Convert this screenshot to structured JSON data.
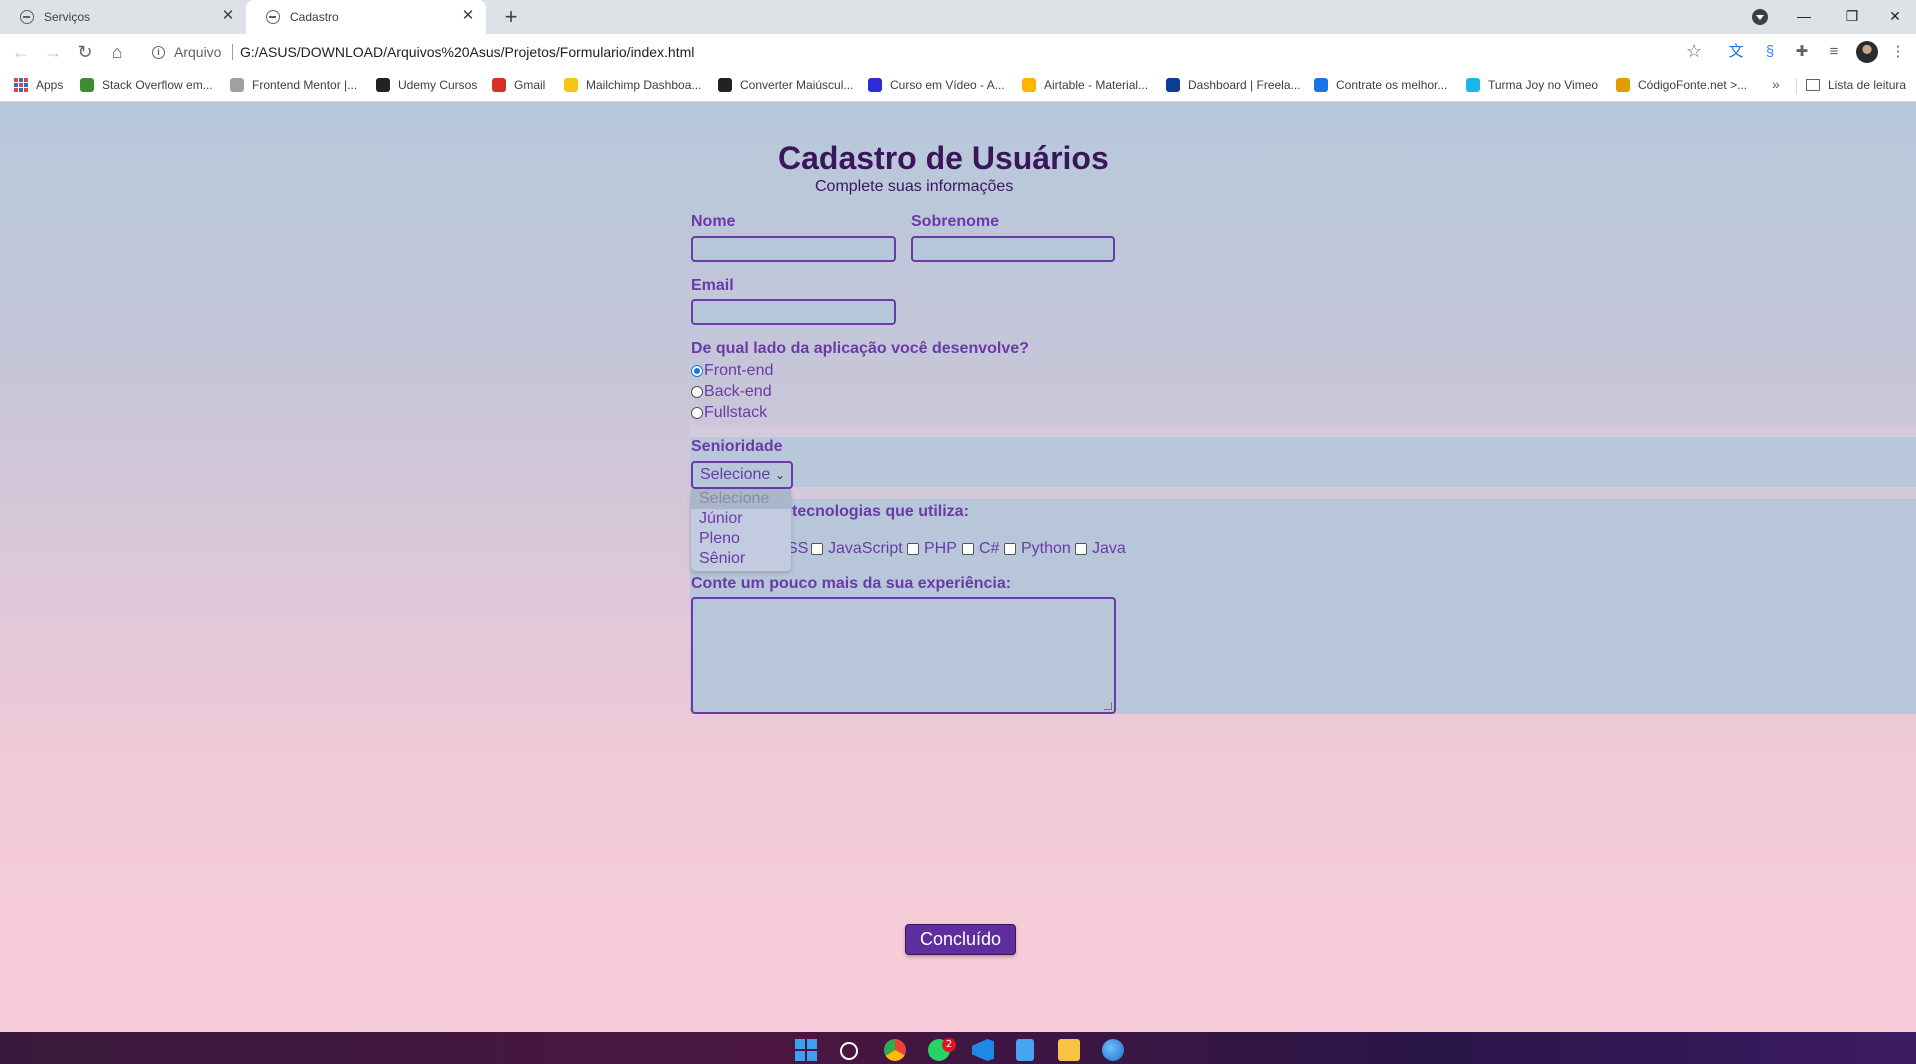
{
  "browser": {
    "tabs": [
      {
        "title": "Serviços",
        "close": "✕"
      },
      {
        "title": "Cadastro",
        "close": "✕"
      }
    ],
    "new_tab": "+",
    "window_controls": {
      "minimize": "—",
      "restore": "❐",
      "close": "✕"
    },
    "nav": {
      "back": "←",
      "forward": "→",
      "reload": "↻",
      "home": "⌂"
    },
    "omnibox": {
      "info": "i",
      "scheme_label": "Arquivo",
      "url": "G:/ASUS/DOWNLOAD/Arquivos%20Asus/Projetos/Formulario/index.html",
      "star": "☆"
    },
    "extension_icons": [
      "translate-icon",
      "extension-s-icon",
      "puzzle-icon",
      "media-icon"
    ],
    "bookmarks": [
      {
        "label": "Apps",
        "color": "#1a73e8"
      },
      {
        "label": "Stack Overflow em...",
        "color": "#3c8d2f"
      },
      {
        "label": "Frontend Mentor |...",
        "color": "#a0a0a0"
      },
      {
        "label": "Udemy Cursos",
        "color": "#222222"
      },
      {
        "label": "Gmail",
        "color": "#d93025"
      },
      {
        "label": "Mailchimp Dashboa...",
        "color": "#f2c811"
      },
      {
        "label": "Converter Maiúscul...",
        "color": "#222222"
      },
      {
        "label": "Curso em Vídeo - A...",
        "color": "#2b2bd8"
      },
      {
        "label": "Airtable - Material...",
        "color": "#fcb400"
      },
      {
        "label": "Dashboard | Freela...",
        "color": "#0b3d91"
      },
      {
        "label": "Contrate os melhor...",
        "color": "#1a73e8"
      },
      {
        "label": "Turma Joy no Vimeo",
        "color": "#1ab7ea"
      },
      {
        "label": "CódigoFonte.net >...",
        "color": "#e09b00"
      }
    ],
    "bookmarks_more": "»",
    "reading_list": "Lista de leitura"
  },
  "form": {
    "title": "Cadastro de Usuários",
    "subtitle": "Complete suas informações",
    "nome_label": "Nome",
    "sobrenome_label": "Sobrenome",
    "email_label": "Email",
    "side_question": "De qual lado da aplicação você desenvolve?",
    "side_options": [
      {
        "label": "Front-end",
        "checked": true
      },
      {
        "label": "Back-end",
        "checked": false
      },
      {
        "label": "Fullstack",
        "checked": false
      }
    ],
    "seniority_label": "Senioridade",
    "seniority_selected": "Selecione",
    "seniority_chevron": "⌄",
    "seniority_options": [
      "Selecione",
      "Júnior",
      "Pleno",
      "Sênior"
    ],
    "tech_label_visible": "tecnologias que utiliza:",
    "tech_options_visible": [
      "SS",
      "JavaScript",
      "PHP",
      "C#",
      "Python",
      "Java"
    ],
    "experience_label": "Conte um pouco mais da sua experiência:",
    "submit_label": "Concluído"
  },
  "taskbar": {
    "icons": [
      "windows-start-icon",
      "search-icon",
      "chrome-icon",
      "whatsapp-icon",
      "vscode-icon",
      "notepad-icon",
      "file-explorer-icon",
      "browser-globe-icon"
    ],
    "whatsapp_badge": "2"
  }
}
